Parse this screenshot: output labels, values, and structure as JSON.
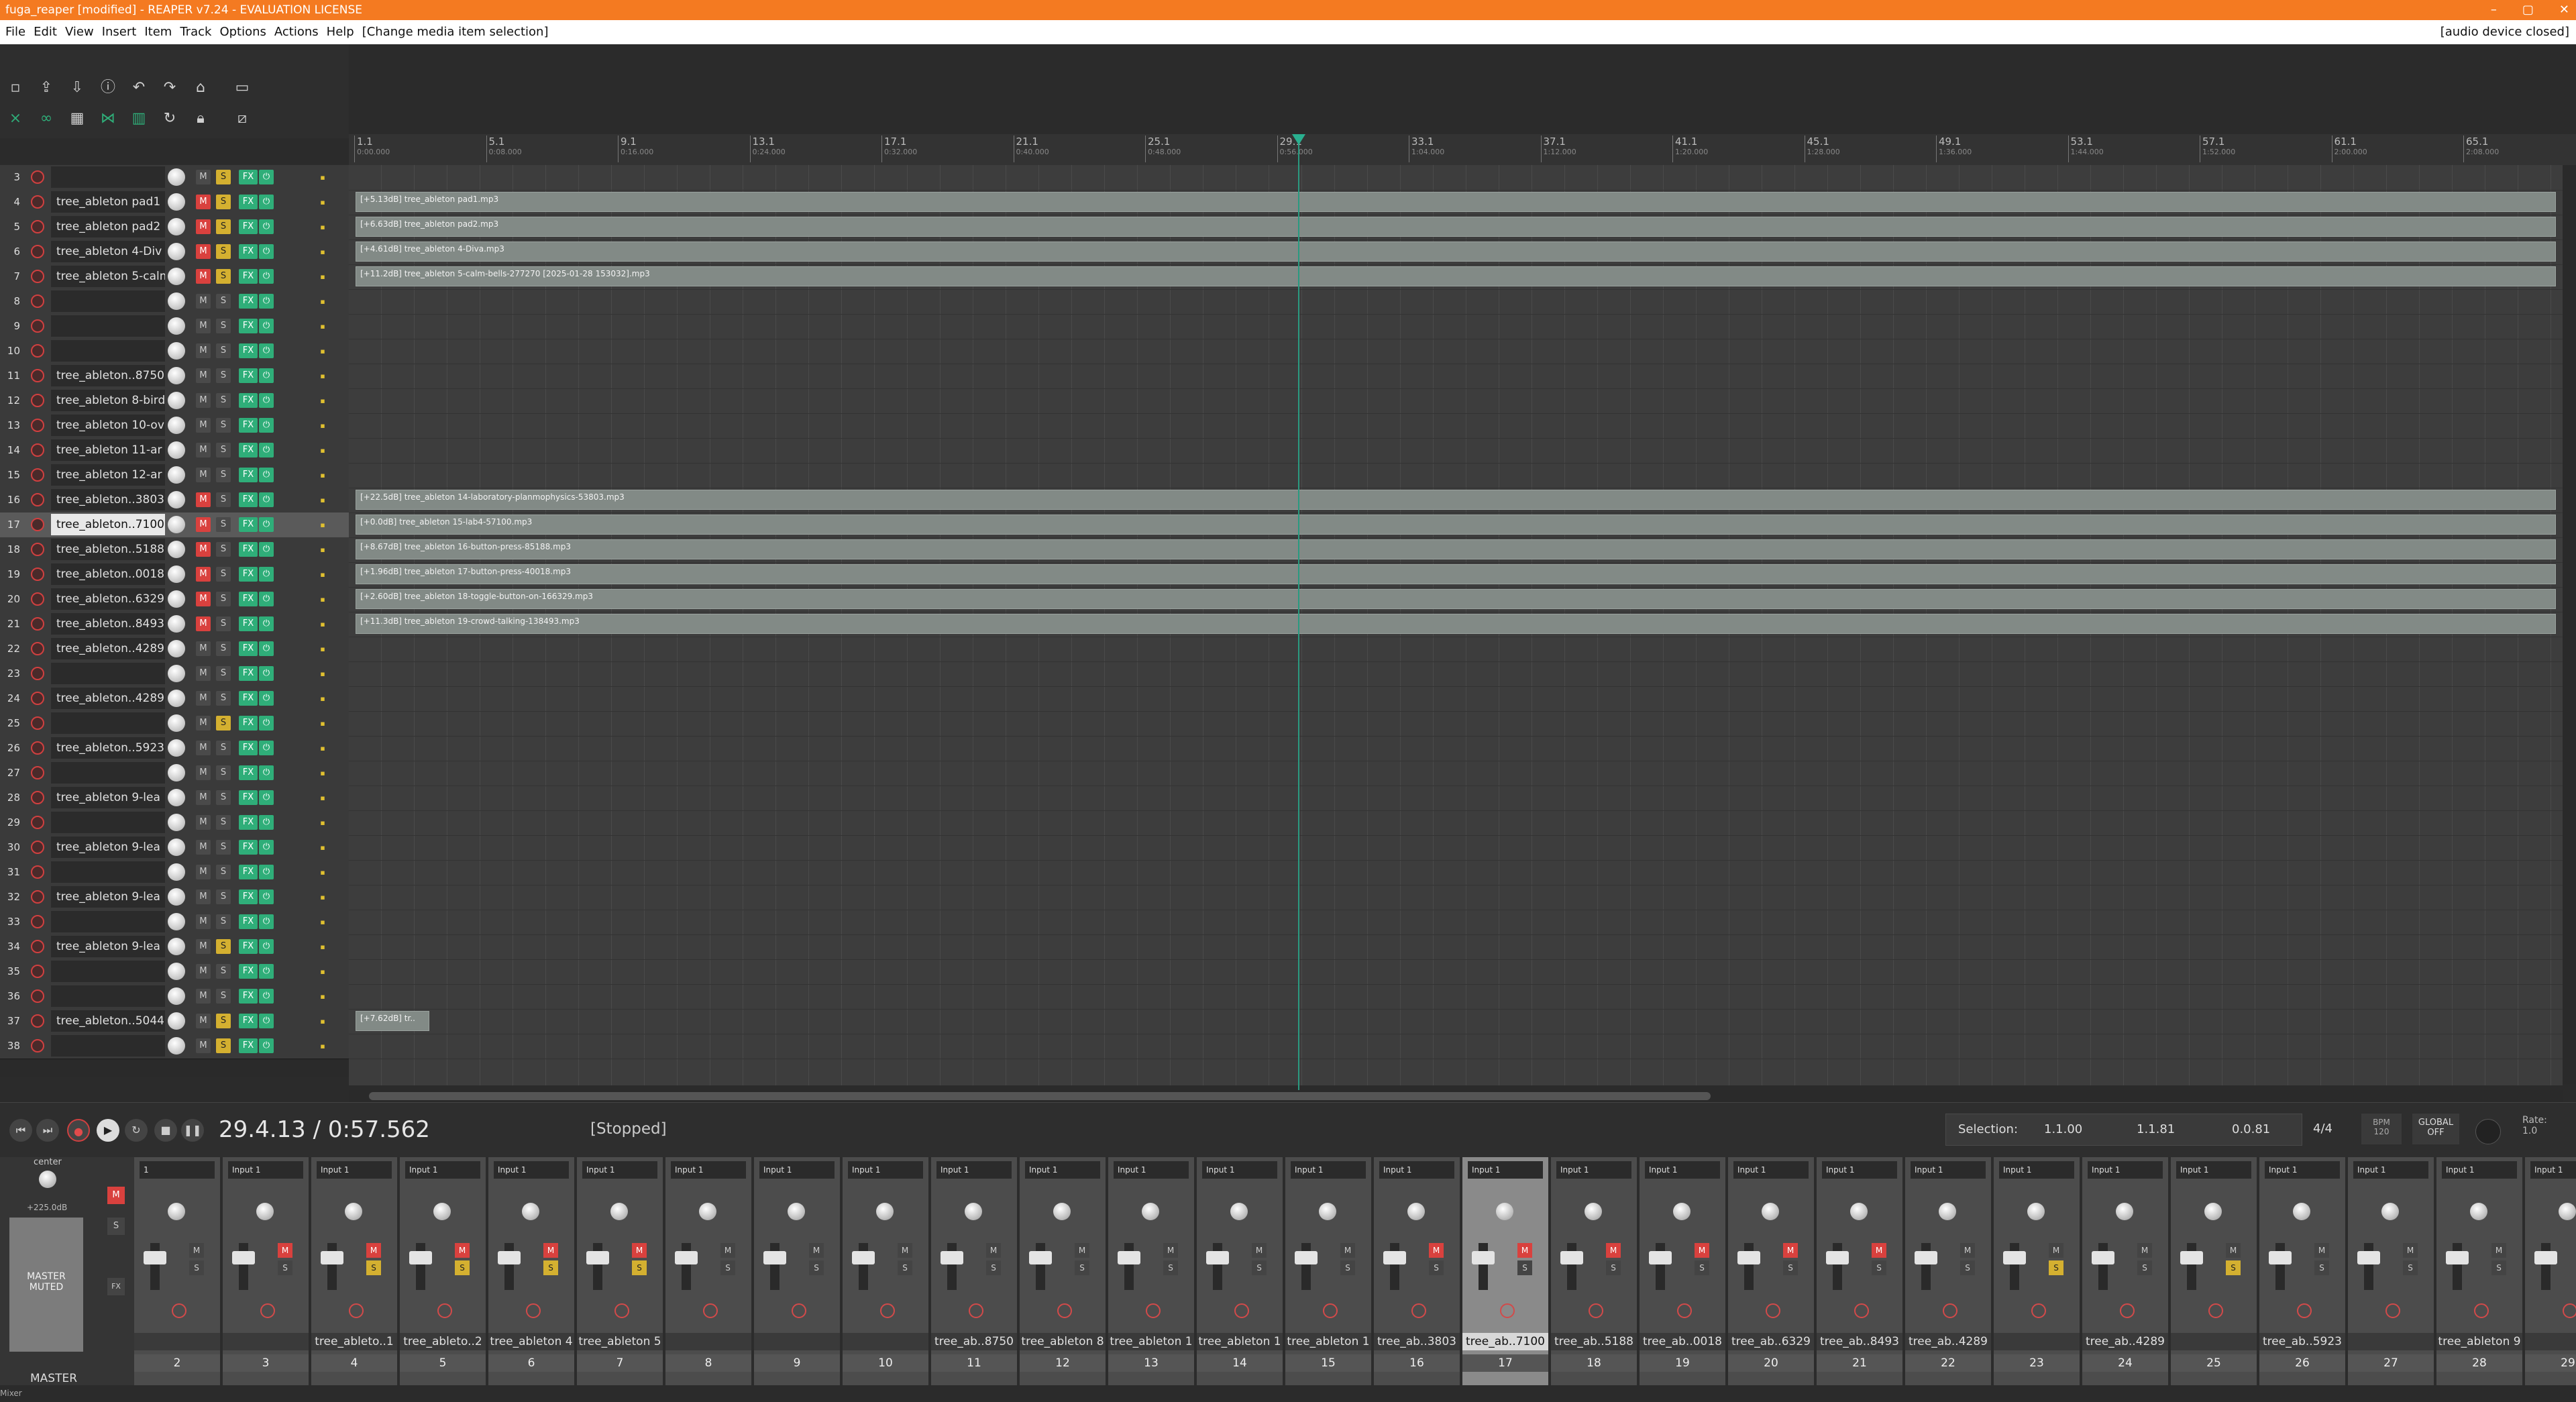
{
  "window": {
    "title": "fuga_reaper [modified] - REAPER v7.24 - EVALUATION LICENSE",
    "controls": [
      "–",
      "▢",
      "✕"
    ]
  },
  "menu": {
    "items": [
      "File",
      "Edit",
      "View",
      "Insert",
      "Item",
      "Track",
      "Options",
      "Actions",
      "Help",
      "[Change media item selection]"
    ],
    "status": "[audio device closed]"
  },
  "ruler": {
    "marks": [
      {
        "bar": "1.1",
        "time": "0:00.000"
      },
      {
        "bar": "5.1",
        "time": "0:08.000"
      },
      {
        "bar": "9.1",
        "time": "0:16.000"
      },
      {
        "bar": "13.1",
        "time": "0:24.000"
      },
      {
        "bar": "17.1",
        "time": "0:32.000"
      },
      {
        "bar": "21.1",
        "time": "0:40.000"
      },
      {
        "bar": "25.1",
        "time": "0:48.000"
      },
      {
        "bar": "29.1",
        "time": "0:56.000"
      },
      {
        "bar": "33.1",
        "time": "1:04.000"
      },
      {
        "bar": "37.1",
        "time": "1:12.000"
      },
      {
        "bar": "41.1",
        "time": "1:20.000"
      },
      {
        "bar": "45.1",
        "time": "1:28.000"
      },
      {
        "bar": "49.1",
        "time": "1:36.000"
      },
      {
        "bar": "53.1",
        "time": "1:44.000"
      },
      {
        "bar": "57.1",
        "time": "1:52.000"
      },
      {
        "bar": "61.1",
        "time": "2:00.000"
      },
      {
        "bar": "65.1",
        "time": "2:08.000"
      }
    ]
  },
  "tracks": [
    {
      "num": "3",
      "name": "",
      "mute": false,
      "solo": true
    },
    {
      "num": "4",
      "name": "tree_ableton pad1",
      "mute": true,
      "solo": true,
      "item": "[+5.13dB] tree_ableton pad1.mp3"
    },
    {
      "num": "5",
      "name": "tree_ableton pad2",
      "mute": true,
      "solo": true,
      "item": "[+6.63dB] tree_ableton pad2.mp3"
    },
    {
      "num": "6",
      "name": "tree_ableton 4-Div",
      "mute": true,
      "solo": true,
      "item": "[+4.61dB] tree_ableton 4-Diva.mp3"
    },
    {
      "num": "7",
      "name": "tree_ableton 5-calm",
      "mute": true,
      "solo": true,
      "item": "[+11.2dB] tree_ableton 5-calm-bells-277270 [2025-01-28 153032].mp3"
    },
    {
      "num": "8",
      "name": "",
      "mute": false,
      "solo": false
    },
    {
      "num": "9",
      "name": "",
      "mute": false,
      "solo": false
    },
    {
      "num": "10",
      "name": "",
      "mute": false,
      "solo": false
    },
    {
      "num": "11",
      "name": "tree_ableton..8750",
      "mute": false,
      "solo": false
    },
    {
      "num": "12",
      "name": "tree_ableton 8-bird",
      "mute": false,
      "solo": false
    },
    {
      "num": "13",
      "name": "tree_ableton 10-ov",
      "mute": false,
      "solo": false
    },
    {
      "num": "14",
      "name": "tree_ableton 11-ar",
      "mute": false,
      "solo": false
    },
    {
      "num": "15",
      "name": "tree_ableton 12-ar",
      "mute": false,
      "solo": false
    },
    {
      "num": "16",
      "name": "tree_ableton..3803",
      "mute": true,
      "solo": false,
      "item": "[+22.5dB] tree_ableton 14-laboratory-planmophysics-53803.mp3"
    },
    {
      "num": "17",
      "name": "tree_ableton..7100",
      "mute": true,
      "solo": false,
      "selected": true,
      "item": "[+0.0dB] tree_ableton 15-lab4-57100.mp3"
    },
    {
      "num": "18",
      "name": "tree_ableton..5188",
      "mute": true,
      "solo": false,
      "item": "[+8.67dB] tree_ableton 16-button-press-85188.mp3"
    },
    {
      "num": "19",
      "name": "tree_ableton..0018",
      "mute": true,
      "solo": false,
      "item": "[+1.96dB] tree_ableton 17-button-press-40018.mp3"
    },
    {
      "num": "20",
      "name": "tree_ableton..6329",
      "mute": true,
      "solo": false,
      "item": "[+2.60dB] tree_ableton 18-toggle-button-on-166329.mp3"
    },
    {
      "num": "21",
      "name": "tree_ableton..8493",
      "mute": true,
      "solo": false,
      "item": "[+11.3dB] tree_ableton 19-crowd-talking-138493.mp3"
    },
    {
      "num": "22",
      "name": "tree_ableton..4289",
      "mute": false,
      "solo": false
    },
    {
      "num": "23",
      "name": "",
      "mute": false,
      "solo": false
    },
    {
      "num": "24",
      "name": "tree_ableton..4289",
      "mute": false,
      "solo": false
    },
    {
      "num": "25",
      "name": "",
      "mute": false,
      "solo": true
    },
    {
      "num": "26",
      "name": "tree_ableton..5923",
      "mute": false,
      "solo": false
    },
    {
      "num": "27",
      "name": "",
      "mute": false,
      "solo": false
    },
    {
      "num": "28",
      "name": "tree_ableton 9-lea",
      "mute": false,
      "solo": false
    },
    {
      "num": "29",
      "name": "",
      "mute": false,
      "solo": false
    },
    {
      "num": "30",
      "name": "tree_ableton 9-lea",
      "mute": false,
      "solo": false
    },
    {
      "num": "31",
      "name": "",
      "mute": false,
      "solo": false
    },
    {
      "num": "32",
      "name": "tree_ableton 9-lea",
      "mute": false,
      "solo": false
    },
    {
      "num": "33",
      "name": "",
      "mute": false,
      "solo": false
    },
    {
      "num": "34",
      "name": "tree_ableton 9-lea",
      "mute": false,
      "solo": true
    },
    {
      "num": "35",
      "name": "",
      "mute": false,
      "solo": false
    },
    {
      "num": "36",
      "name": "",
      "mute": false,
      "solo": false
    },
    {
      "num": "37",
      "name": "tree_ableton..5044",
      "mute": false,
      "solo": true,
      "item": "[+7.62dB] tr.."
    },
    {
      "num": "38",
      "name": "",
      "mute": false,
      "solo": true
    }
  ],
  "transport": {
    "position": "29.4.13 / 0:57.562",
    "state": "[Stopped]",
    "selection_label": "Selection:",
    "sel_start": "1.1.00",
    "sel_end": "1.1.81",
    "sel_len": "0.0.81",
    "time_sig": "4/4",
    "bpm_label": "BPM",
    "bpm": "120",
    "global_label": "GLOBAL",
    "global_state": "OFF",
    "rate_label": "Rate:",
    "rate": "1.0"
  },
  "master": {
    "pan": "center",
    "db": "+225.0dB",
    "muted_text": "MASTER MUTED",
    "label": "MASTER"
  },
  "mixer": {
    "strips": [
      {
        "num": "2",
        "input": "1",
        "name": "",
        "mute": false,
        "solo": false
      },
      {
        "num": "3",
        "input": "Input 1",
        "name": "",
        "mute": true,
        "solo": false
      },
      {
        "num": "4",
        "input": "Input 1",
        "name": "tree_ableto..1",
        "mute": true,
        "solo": true
      },
      {
        "num": "5",
        "input": "Input 1",
        "name": "tree_ableto..2",
        "mute": true,
        "solo": true
      },
      {
        "num": "6",
        "input": "Input 1",
        "name": "tree_ableton 4",
        "mute": true,
        "solo": true
      },
      {
        "num": "7",
        "input": "Input 1",
        "name": "tree_ableton 5",
        "mute": true,
        "solo": true
      },
      {
        "num": "8",
        "input": "Input 1",
        "name": "",
        "mute": false,
        "solo": false
      },
      {
        "num": "9",
        "input": "Input 1",
        "name": "",
        "mute": false,
        "solo": false
      },
      {
        "num": "10",
        "input": "Input 1",
        "name": "",
        "mute": false,
        "solo": false
      },
      {
        "num": "11",
        "input": "Input 1",
        "name": "tree_ab..8750",
        "mute": false,
        "solo": false
      },
      {
        "num": "12",
        "input": "Input 1",
        "name": "tree_ableton 8",
        "mute": false,
        "solo": false
      },
      {
        "num": "13",
        "input": "Input 1",
        "name": "tree_ableton 1",
        "mute": false,
        "solo": false
      },
      {
        "num": "14",
        "input": "Input 1",
        "name": "tree_ableton 1",
        "mute": false,
        "solo": false
      },
      {
        "num": "15",
        "input": "Input 1",
        "name": "tree_ableton 1",
        "mute": false,
        "solo": false
      },
      {
        "num": "16",
        "input": "Input 1",
        "name": "tree_ab..3803",
        "mute": true,
        "solo": false
      },
      {
        "num": "17",
        "input": "Input 1",
        "name": "tree_ab..7100",
        "mute": true,
        "solo": false,
        "selected": true
      },
      {
        "num": "18",
        "input": "Input 1",
        "name": "tree_ab..5188",
        "mute": true,
        "solo": false
      },
      {
        "num": "19",
        "input": "Input 1",
        "name": "tree_ab..0018",
        "mute": true,
        "solo": false
      },
      {
        "num": "20",
        "input": "Input 1",
        "name": "tree_ab..6329",
        "mute": true,
        "solo": false
      },
      {
        "num": "21",
        "input": "Input 1",
        "name": "tree_ab..8493",
        "mute": true,
        "solo": false
      },
      {
        "num": "22",
        "input": "Input 1",
        "name": "tree_ab..4289",
        "mute": false,
        "solo": false
      },
      {
        "num": "23",
        "input": "Input 1",
        "name": "",
        "mute": false,
        "solo": true
      },
      {
        "num": "24",
        "input": "Input 1",
        "name": "tree_ab..4289",
        "mute": false,
        "solo": false
      },
      {
        "num": "25",
        "input": "Input 1",
        "name": "",
        "mute": false,
        "solo": true
      },
      {
        "num": "26",
        "input": "Input 1",
        "name": "tree_ab..5923",
        "mute": false,
        "solo": false
      },
      {
        "num": "27",
        "input": "Input 1",
        "name": "",
        "mute": false,
        "solo": false
      },
      {
        "num": "28",
        "input": "Input 1",
        "name": "tree_ableton 9",
        "mute": false,
        "solo": false
      },
      {
        "num": "29",
        "input": "Input 1",
        "name": "",
        "mute": false,
        "solo": false
      }
    ]
  },
  "labels": {
    "mute": "M",
    "solo": "S",
    "fx": "FX",
    "io": "⏻",
    "in": "in"
  },
  "mixer_tab": "Mixer",
  "colors": {
    "titlebar": "#f47a21",
    "fx_green": "#2fae79",
    "mute_red": "#d9413e",
    "solo_yellow": "#d4b030",
    "cursor": "#2a9a80"
  }
}
